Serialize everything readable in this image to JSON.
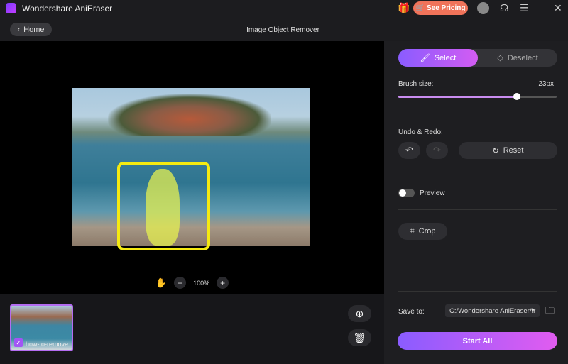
{
  "app": {
    "title": "Wondershare AniEraser",
    "pricing_label": "See Pricing"
  },
  "header": {
    "home_label": "Home",
    "page_title": "Image Object Remover"
  },
  "canvas": {
    "zoom_level": "100%"
  },
  "thumbnail": {
    "label": "how-to-remove"
  },
  "panel": {
    "select_label": "Select",
    "deselect_label": "Deselect",
    "brush_label": "Brush size:",
    "brush_value": "23px",
    "brush_fraction": 0.75,
    "undo_redo_label": "Undo & Redo:",
    "reset_label": "Reset",
    "preview_label": "Preview",
    "preview_on": false,
    "crop_label": "Crop",
    "save_to_label": "Save to:",
    "save_path": "C:/Wondershare AniEraser/Ir",
    "start_label": "Start All"
  },
  "colors": {
    "accent_start": "#8a5cff",
    "accent_end": "#e15cf0",
    "selection_box": "#f5ea11",
    "pricing": "#f0735a"
  }
}
